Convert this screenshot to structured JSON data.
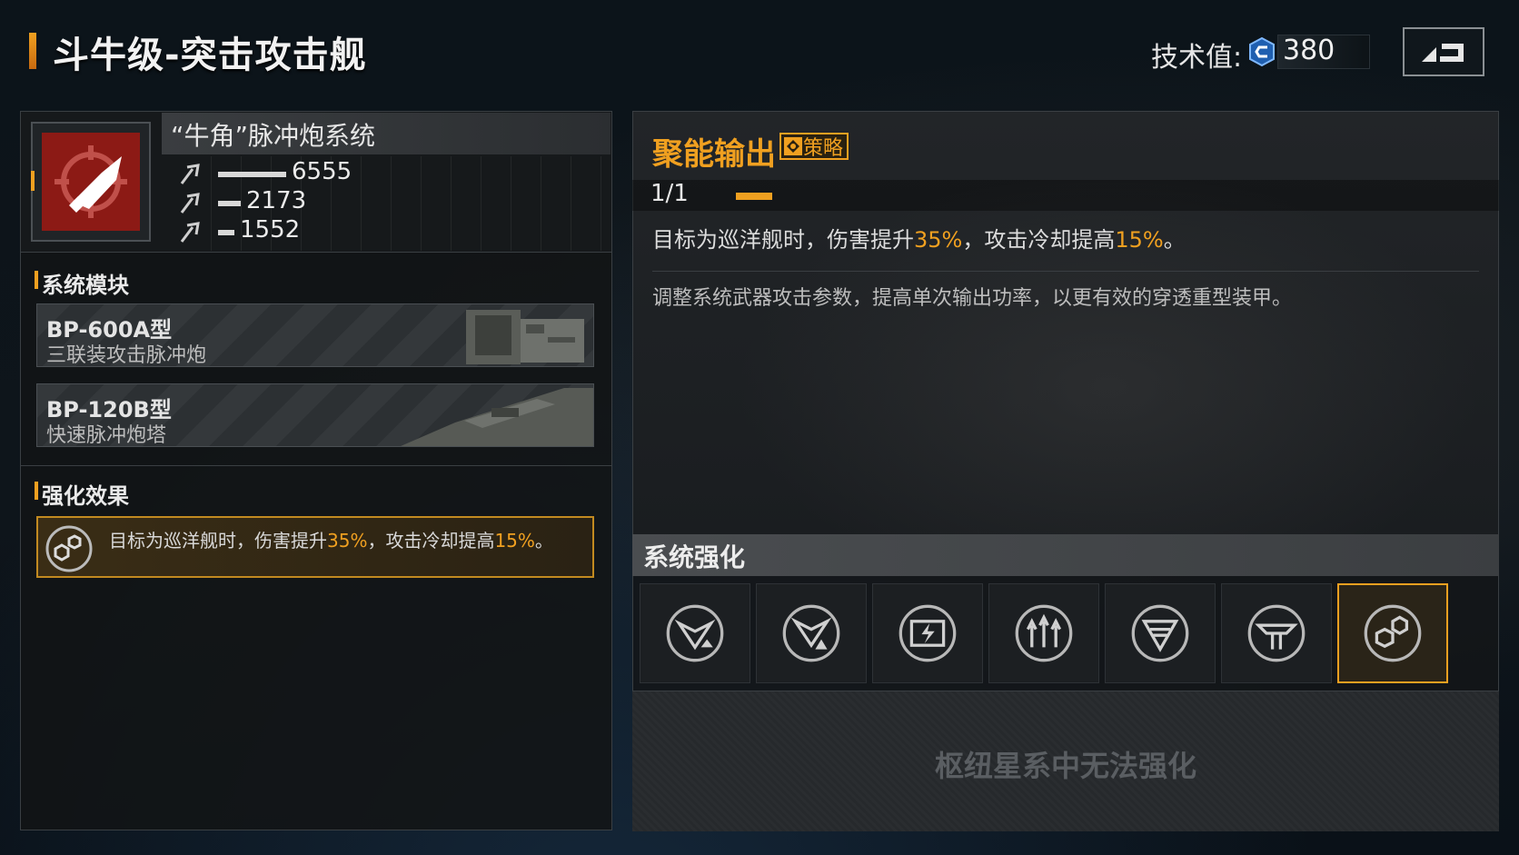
{
  "header": {
    "ship_title": "斗牛级-突击攻击舰",
    "tech_label": "技术值:",
    "tech_value": "380"
  },
  "weapon": {
    "name": "“牛角”脉冲炮系统",
    "icon": "bullet-icon",
    "stats": [
      {
        "icon": "attack-stat-icon",
        "value": "6555",
        "fill": 0.75
      },
      {
        "icon": "attack-stat-icon",
        "value": "2173",
        "fill": 0.25
      },
      {
        "icon": "attack-stat-icon",
        "value": "1552",
        "fill": 0.18
      }
    ]
  },
  "modules": {
    "title": "系统模块",
    "items": [
      {
        "code": "BP-600A型",
        "desc": "三联装攻击脉冲炮"
      },
      {
        "code": "BP-120B型",
        "desc": "快速脉冲炮塔"
      }
    ]
  },
  "enhance_effect": {
    "title": "强化效果",
    "text_1": "目标为巡洋舰时，伤害提升",
    "pct_1": "35%",
    "text_2": "，攻击冷却提高",
    "pct_2": "15%",
    "text_3": "。"
  },
  "skill": {
    "name": "聚能输出",
    "tag": "策略",
    "level": "1/1",
    "effect_1": "目标为巡洋舰时，伤害提升",
    "effect_pct_1": "35%",
    "effect_2": "，攻击冷却提高",
    "effect_pct_2": "15%",
    "effect_3": "。",
    "description": "调整系统武器攻击参数，提高单次输出功率，以更有效的穿透重型装甲。"
  },
  "system_enhance": {
    "title": "系统强化",
    "slots": [
      {
        "icon": "damage-up-icon",
        "selected": false
      },
      {
        "icon": "damage-up-alt-icon",
        "selected": false
      },
      {
        "icon": "energy-icon",
        "selected": false
      },
      {
        "icon": "speed-up-icon",
        "selected": false
      },
      {
        "icon": "shield-icon",
        "selected": false
      },
      {
        "icon": "turret-icon",
        "selected": false
      },
      {
        "icon": "hexagon-gear-icon",
        "selected": true
      }
    ],
    "locked_text": "枢纽星系中无法强化"
  },
  "colors": {
    "accent": "#f0a020",
    "weapon_icon_bg": "#8c1a15"
  }
}
